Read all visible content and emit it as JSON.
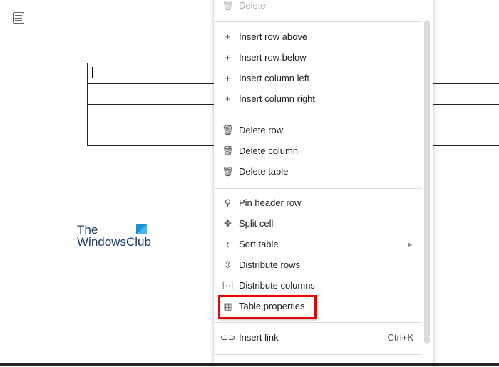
{
  "document": {
    "logo_text_line1": "The",
    "logo_text_line2": "WindowsClub"
  },
  "menu": {
    "items": [
      {
        "label": "Delete",
        "icon": "trash-icon",
        "disabled": true
      },
      {
        "label": "Insert row above",
        "icon": "plus-icon"
      },
      {
        "label": "Insert row below",
        "icon": "plus-icon"
      },
      {
        "label": "Insert column left",
        "icon": "plus-icon"
      },
      {
        "label": "Insert column right",
        "icon": "plus-icon"
      },
      {
        "label": "Delete row",
        "icon": "trash-icon"
      },
      {
        "label": "Delete column",
        "icon": "trash-icon"
      },
      {
        "label": "Delete table",
        "icon": "trash-icon"
      },
      {
        "label": "Pin header row",
        "icon": "pin-icon"
      },
      {
        "label": "Split cell",
        "icon": "split-cell-icon"
      },
      {
        "label": "Sort table",
        "icon": "sort-icon",
        "submenu": "►"
      },
      {
        "label": "Distribute rows",
        "icon": "distribute-rows-icon"
      },
      {
        "label": "Distribute columns",
        "icon": "distribute-columns-icon"
      },
      {
        "label": "Table properties",
        "icon": "table-icon",
        "highlighted": true
      },
      {
        "label": "Insert link",
        "icon": "link-icon",
        "shortcut": "Ctrl+K"
      }
    ]
  },
  "highlight_color": "#e00000"
}
